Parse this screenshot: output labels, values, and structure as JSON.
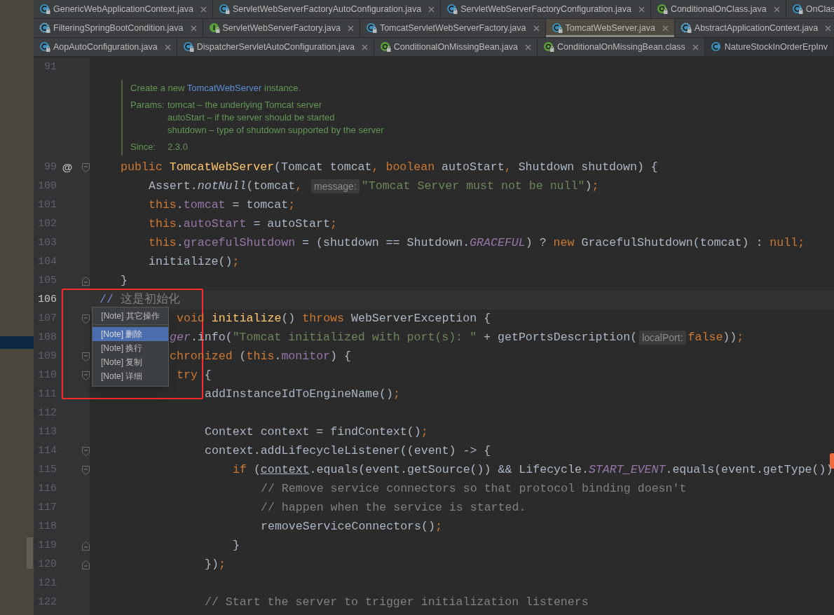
{
  "tab_rows": [
    {
      "tabs": [
        {
          "label": "GenericWebApplicationContext.java",
          "kind": "class",
          "locked": true,
          "closable": true,
          "selected": false
        },
        {
          "label": "ServletWebServerFactoryAutoConfiguration.java",
          "kind": "class",
          "locked": true,
          "closable": true,
          "selected": false
        },
        {
          "label": "ServletWebServerFactoryConfiguration.java",
          "kind": "class",
          "locked": true,
          "closable": true,
          "selected": false
        },
        {
          "label": "ConditionalOnClass.java",
          "kind": "annotation",
          "locked": true,
          "closable": true,
          "selected": false
        },
        {
          "label": "OnClas",
          "kind": "class",
          "locked": true,
          "closable": false,
          "selected": false
        }
      ]
    },
    {
      "tabs": [
        {
          "label": "FilteringSpringBootCondition.java",
          "kind": "abstract",
          "locked": true,
          "closable": true,
          "selected": false
        },
        {
          "label": "ServletWebServerFactory.java",
          "kind": "interface",
          "locked": true,
          "closable": true,
          "selected": false
        },
        {
          "label": "TomcatServletWebServerFactory.java",
          "kind": "class",
          "locked": true,
          "closable": true,
          "selected": false
        },
        {
          "label": "TomcatWebServer.java",
          "kind": "class",
          "locked": true,
          "closable": true,
          "selected": true
        },
        {
          "label": "AbstractApplicationContext.java",
          "kind": "abstract",
          "locked": true,
          "closable": true,
          "selected": false
        }
      ]
    },
    {
      "tabs": [
        {
          "label": "AopAutoConfiguration.java",
          "kind": "class",
          "locked": true,
          "closable": true,
          "selected": false
        },
        {
          "label": "DispatcherServletAutoConfiguration.java",
          "kind": "class",
          "locked": true,
          "closable": true,
          "selected": false
        },
        {
          "label": "ConditionalOnMissingBean.java",
          "kind": "annotation",
          "locked": true,
          "closable": true,
          "selected": false
        },
        {
          "label": "ConditionalOnMissingBean.class",
          "kind": "annotation",
          "locked": true,
          "closable": true,
          "selected": false
        },
        {
          "label": "NatureStockInOrderErpInv",
          "kind": "class",
          "locked": false,
          "closable": false,
          "selected": false
        }
      ]
    }
  ],
  "editor": {
    "lines": [
      {
        "kind": "code",
        "number": "91",
        "current": false
      },
      {
        "kind": "doc",
        "summary": [
          {
            "text": "Create a new ",
            "kind": "text"
          },
          {
            "text": "TomcatWebServer",
            "kind": "code"
          },
          {
            "text": " instance.",
            "kind": "text"
          }
        ],
        "params_label": "Params:",
        "params": [
          "tomcat – the underlying Tomcat server",
          "autoStart – if the server should be started",
          "shutdown – type of shutdown supported by the server"
        ],
        "since_label": "Since:",
        "since": "2.3.0"
      },
      {
        "kind": "code",
        "number": "99",
        "current": false,
        "marker": "@",
        "fold_open": true,
        "tokens": [
          {
            "text": "    public ",
            "kind": "kw"
          },
          {
            "text": "TomcatWebServer",
            "kind": "decl"
          },
          {
            "text": "(Tomcat tomcat",
            "kind": "plain"
          },
          {
            "text": ", boolean ",
            "kind": "kw"
          },
          {
            "text": "autoStart",
            "kind": "plain"
          },
          {
            "text": ", ",
            "kind": "kw"
          },
          {
            "text": "Shutdown shutdown) {",
            "kind": "plain"
          }
        ]
      },
      {
        "kind": "code",
        "number": "100",
        "current": false,
        "tokens": [
          {
            "text": "        Assert.",
            "kind": "plain"
          },
          {
            "text": "notNull",
            "kind": "italic"
          },
          {
            "text": "(tomcat",
            "kind": "plain"
          },
          {
            "text": ", ",
            "kind": "kw"
          },
          {
            "text": "message:",
            "kind": "hint"
          },
          {
            "text": "\"Tomcat Server must not be null\"",
            "kind": "str"
          },
          {
            "text": ")",
            "kind": "plain"
          },
          {
            "text": ";",
            "kind": "kw"
          }
        ]
      },
      {
        "kind": "code",
        "number": "101",
        "current": false,
        "tokens": [
          {
            "text": "        this",
            "kind": "kw"
          },
          {
            "text": ".",
            "kind": "plain"
          },
          {
            "text": "tomcat",
            "kind": "field"
          },
          {
            "text": " = tomcat",
            "kind": "plain"
          },
          {
            "text": ";",
            "kind": "kw"
          }
        ]
      },
      {
        "kind": "code",
        "number": "102",
        "current": false,
        "tokens": [
          {
            "text": "        this",
            "kind": "kw"
          },
          {
            "text": ".",
            "kind": "plain"
          },
          {
            "text": "autoStart",
            "kind": "field"
          },
          {
            "text": " = autoStart",
            "kind": "plain"
          },
          {
            "text": ";",
            "kind": "kw"
          }
        ]
      },
      {
        "kind": "code",
        "number": "103",
        "current": false,
        "tokens": [
          {
            "text": "        this",
            "kind": "kw"
          },
          {
            "text": ".",
            "kind": "plain"
          },
          {
            "text": "gracefulShutdown",
            "kind": "field"
          },
          {
            "text": " = (shutdown == Shutdown.",
            "kind": "plain"
          },
          {
            "text": "GRACEFUL",
            "kind": "const"
          },
          {
            "text": ") ? ",
            "kind": "plain"
          },
          {
            "text": "new ",
            "kind": "kw"
          },
          {
            "text": "GracefulShutdown(tomcat) : ",
            "kind": "plain"
          },
          {
            "text": "null;",
            "kind": "kw"
          }
        ]
      },
      {
        "kind": "code",
        "number": "104",
        "current": false,
        "tokens": [
          {
            "text": "        initialize()",
            "kind": "plain"
          },
          {
            "text": ";",
            "kind": "kw"
          }
        ]
      },
      {
        "kind": "code",
        "number": "105",
        "current": false,
        "fold_close": true,
        "tokens": [
          {
            "text": "    }",
            "kind": "plain"
          }
        ]
      },
      {
        "kind": "code",
        "number": "106",
        "current": true,
        "tokens": [
          {
            "text": " //",
            "kind": "slash"
          },
          {
            "text": " 这是初始化",
            "kind": "comment"
          }
        ]
      },
      {
        "kind": "code",
        "number": "107",
        "current": false,
        "fold_open": true,
        "tokens": [
          {
            "text": "            void ",
            "kind": "kw"
          },
          {
            "text": "initialize",
            "kind": "decl"
          },
          {
            "text": "() ",
            "kind": "plain"
          },
          {
            "text": "throws ",
            "kind": "kw"
          },
          {
            "text": "WebServerException {",
            "kind": "plain"
          }
        ]
      },
      {
        "kind": "code",
        "number": "108",
        "current": false,
        "tokens": [
          {
            "text": "           ger",
            "kind": "const"
          },
          {
            "text": ".info(",
            "kind": "plain"
          },
          {
            "text": "\"Tomcat initialized with port(s): \"",
            "kind": "str"
          },
          {
            "text": " + getPortsDescription(",
            "kind": "plain"
          },
          {
            "text": "localPort:",
            "kind": "hint"
          },
          {
            "text": "false",
            "kind": "kw"
          },
          {
            "text": "))",
            "kind": "plain"
          },
          {
            "text": ";",
            "kind": "kw"
          }
        ]
      },
      {
        "kind": "code",
        "number": "109",
        "current": false,
        "fold_open": true,
        "tokens": [
          {
            "text": "           chronized ",
            "kind": "kw"
          },
          {
            "text": "(",
            "kind": "plain"
          },
          {
            "text": "this",
            "kind": "kw"
          },
          {
            "text": ".",
            "kind": "plain"
          },
          {
            "text": "monitor",
            "kind": "field"
          },
          {
            "text": ") {",
            "kind": "plain"
          }
        ]
      },
      {
        "kind": "code",
        "number": "110",
        "current": false,
        "fold_open": true,
        "tokens": [
          {
            "text": "            try ",
            "kind": "kw"
          },
          {
            "text": "{",
            "kind": "plain"
          }
        ]
      },
      {
        "kind": "code",
        "number": "111",
        "current": false,
        "tokens": [
          {
            "text": "                addInstanceIdToEngineName()",
            "kind": "plain"
          },
          {
            "text": ";",
            "kind": "kw"
          }
        ]
      },
      {
        "kind": "code",
        "number": "112",
        "current": false
      },
      {
        "kind": "code",
        "number": "113",
        "current": false,
        "tokens": [
          {
            "text": "                Context context = findContext()",
            "kind": "plain"
          },
          {
            "text": ";",
            "kind": "kw"
          }
        ]
      },
      {
        "kind": "code",
        "number": "114",
        "current": false,
        "fold_open": true,
        "tokens": [
          {
            "text": "                context.addLifecycleListener((event) -> {",
            "kind": "plain"
          }
        ]
      },
      {
        "kind": "code",
        "number": "115",
        "current": false,
        "fold_open": true,
        "tokens": [
          {
            "text": "                    if ",
            "kind": "kw"
          },
          {
            "text": "(",
            "kind": "plain"
          },
          {
            "text": "context",
            "kind": "underlined"
          },
          {
            "text": ".equals(event.getSource()) && Lifecycle.",
            "kind": "plain"
          },
          {
            "text": "START_EVENT",
            "kind": "const"
          },
          {
            "text": ".equals(event.getType())",
            "kind": "plain"
          }
        ]
      },
      {
        "kind": "code",
        "number": "116",
        "current": false,
        "tokens": [
          {
            "text": "                        // Remove service connectors so that protocol binding doesn't",
            "kind": "comment"
          }
        ]
      },
      {
        "kind": "code",
        "number": "117",
        "current": false,
        "tokens": [
          {
            "text": "                        // happen when the service is started.",
            "kind": "comment"
          }
        ]
      },
      {
        "kind": "code",
        "number": "118",
        "current": false,
        "tokens": [
          {
            "text": "                        removeServiceConnectors()",
            "kind": "plain"
          },
          {
            "text": ";",
            "kind": "kw"
          }
        ]
      },
      {
        "kind": "code",
        "number": "119",
        "current": false,
        "fold_close": true,
        "tokens": [
          {
            "text": "                    }",
            "kind": "plain"
          }
        ]
      },
      {
        "kind": "code",
        "number": "120",
        "current": false,
        "fold_close": true,
        "tokens": [
          {
            "text": "                })",
            "kind": "plain"
          },
          {
            "text": ";",
            "kind": "kw"
          }
        ]
      },
      {
        "kind": "code",
        "number": "121",
        "current": false
      },
      {
        "kind": "code",
        "number": "122",
        "current": false,
        "tokens": [
          {
            "text": "                // Start the server to trigger initialization listeners",
            "kind": "comment"
          }
        ]
      }
    ]
  },
  "popup_menu": {
    "header": "[Note] 其它操作",
    "items": [
      {
        "label": "[Note] 删除",
        "selected": true
      },
      {
        "label": "[Note] 换行",
        "selected": false
      },
      {
        "label": "[Note] 复制",
        "selected": false
      },
      {
        "label": "[Note] 详细",
        "selected": false
      }
    ]
  }
}
